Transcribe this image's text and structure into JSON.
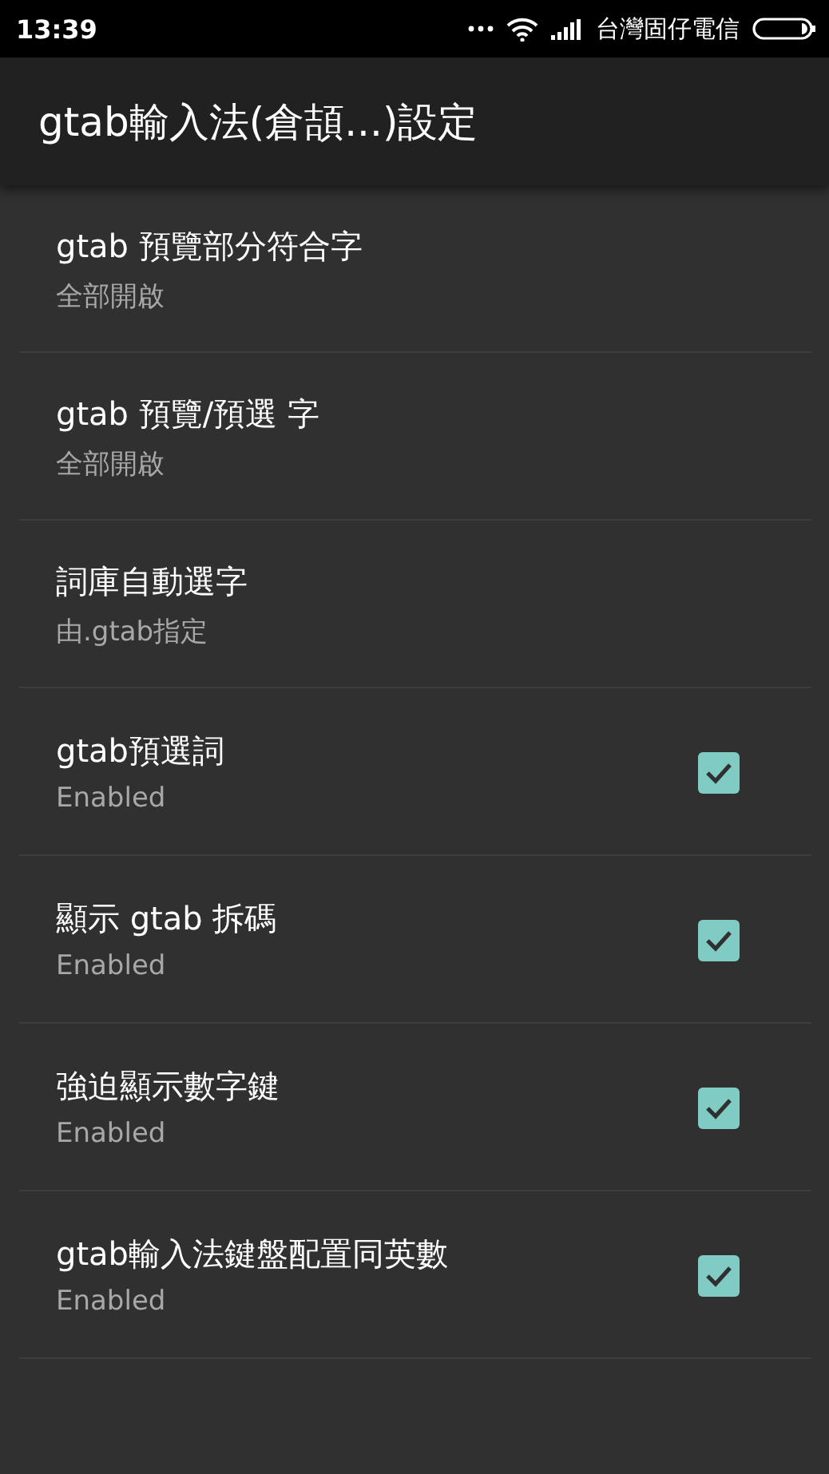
{
  "status_bar": {
    "time": "13:39",
    "carrier": "台灣固仔電信"
  },
  "app_bar": {
    "title": "gtab輸入法(倉頡...)設定"
  },
  "settings": [
    {
      "kind": "list",
      "title": "gtab 預覽部分符合字",
      "summary": "全部開啟"
    },
    {
      "kind": "list",
      "title": "gtab 預覽/預選 字",
      "summary": "全部開啟"
    },
    {
      "kind": "list",
      "title": "詞庫自動選字",
      "summary": "由.gtab指定"
    },
    {
      "kind": "checkbox",
      "title": "gtab預選詞",
      "summary": "Enabled",
      "checked": true
    },
    {
      "kind": "checkbox",
      "title": "顯示 gtab 拆碼",
      "summary": "Enabled",
      "checked": true
    },
    {
      "kind": "checkbox",
      "title": "強迫顯示數字鍵",
      "summary": "Enabled",
      "checked": true
    },
    {
      "kind": "checkbox",
      "title": "gtab輸入法鍵盤配置同英數",
      "summary": "Enabled",
      "checked": true
    }
  ]
}
